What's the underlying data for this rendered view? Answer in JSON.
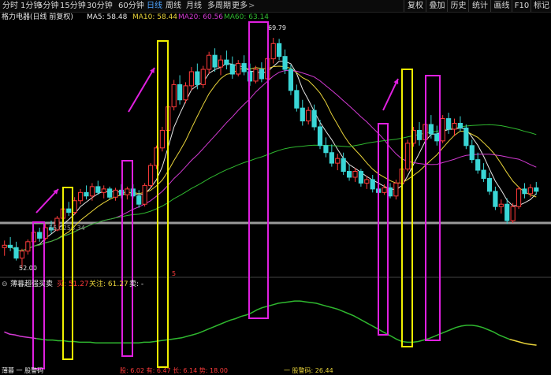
{
  "toolbar": {
    "periods": [
      "分时",
      "1分钟",
      "5分钟",
      "15分钟",
      "30分钟",
      "60分钟",
      "日线",
      "周线",
      "月线",
      "多周期",
      "更多"
    ],
    "active_index": 6,
    "more_arrow": ">",
    "right_buttons": [
      "复权",
      "叠加",
      "历史",
      "统计",
      "画线",
      "F10",
      "标记"
    ]
  },
  "title": {
    "stock": "格力电器(日线 前复权)",
    "ma5": "MA5: 58.48",
    "ma10": "MA10: 58.44",
    "ma20": "MA20: 60.56",
    "ma60": "MA60: 63.14"
  },
  "price_labels": {
    "high": "69.79",
    "low": "52.00",
    "ref_line": "55.0256.34",
    "marker": "5"
  },
  "indicator": {
    "name": "薄暮超强买卖",
    "buy": "买: 51.27",
    "watch": "关注: 61.27",
    "sell": "卖: -"
  },
  "bottom": {
    "left": "薄暮 一 股警码",
    "mid": "股: 6.02  有: 6.47  长: 6.14  势: 18.00",
    "right": "一 股警码: 26.44"
  },
  "colors": {
    "up": "#ff3b3b",
    "down": "#3ad6d6",
    "ma5": "#e8e8e8",
    "ma10": "#e8d33a",
    "ma20": "#d33ad3",
    "ma60": "#2fb82f",
    "box_magenta": "#e020e0",
    "box_yellow": "#f0f000",
    "arrow": "#e020e0"
  },
  "chart_data": {
    "type": "candlestick",
    "ohlc": [
      [
        51.9,
        52.5,
        51.2,
        52.1
      ],
      [
        52.1,
        52.8,
        51.6,
        51.9
      ],
      [
        51.9,
        52.4,
        50.8,
        51.0
      ],
      [
        51.0,
        51.8,
        50.2,
        51.6
      ],
      [
        51.6,
        52.6,
        51.3,
        52.4
      ],
      [
        52.4,
        53.4,
        52.1,
        53.2
      ],
      [
        53.2,
        53.6,
        52.4,
        52.7
      ],
      [
        52.7,
        53.9,
        52.5,
        53.6
      ],
      [
        53.6,
        54.2,
        53.1,
        53.4
      ],
      [
        53.4,
        54.6,
        53.3,
        54.4
      ],
      [
        54.4,
        55.5,
        54.1,
        55.2
      ],
      [
        55.2,
        55.8,
        54.6,
        54.9
      ],
      [
        54.9,
        56.2,
        54.7,
        55.9
      ],
      [
        55.9,
        56.9,
        55.6,
        56.6
      ],
      [
        56.6,
        57.2,
        56.0,
        56.3
      ],
      [
        56.3,
        57.4,
        55.9,
        57.1
      ],
      [
        57.1,
        57.6,
        56.4,
        56.6
      ],
      [
        56.6,
        57.2,
        56.1,
        56.9
      ],
      [
        56.9,
        57.1,
        56.0,
        56.2
      ],
      [
        56.2,
        57.0,
        55.9,
        56.8
      ],
      [
        56.8,
        57.3,
        56.1,
        56.4
      ],
      [
        56.4,
        57.1,
        56.0,
        56.9
      ],
      [
        56.9,
        57.3,
        56.1,
        56.3
      ],
      [
        56.3,
        56.8,
        55.3,
        55.6
      ],
      [
        55.6,
        57.4,
        55.4,
        57.2
      ],
      [
        57.2,
        59.1,
        57.0,
        58.9
      ],
      [
        58.9,
        60.6,
        58.6,
        60.4
      ],
      [
        60.4,
        62.2,
        60.1,
        61.9
      ],
      [
        61.9,
        64.2,
        61.6,
        63.9
      ],
      [
        63.9,
        66.2,
        63.6,
        65.8
      ],
      [
        65.8,
        66.6,
        64.1,
        64.5
      ],
      [
        64.5,
        66.0,
        64.2,
        65.7
      ],
      [
        65.7,
        67.3,
        65.3,
        66.9
      ],
      [
        66.9,
        67.6,
        65.4,
        65.8
      ],
      [
        65.8,
        67.4,
        65.5,
        67.1
      ],
      [
        67.1,
        68.6,
        66.7,
        68.3
      ],
      [
        68.3,
        68.9,
        66.9,
        67.3
      ],
      [
        67.3,
        68.3,
        66.6,
        67.9
      ],
      [
        67.9,
        68.7,
        67.1,
        67.5
      ],
      [
        67.5,
        68.2,
        66.3,
        66.7
      ],
      [
        66.7,
        67.9,
        66.5,
        67.6
      ],
      [
        67.6,
        68.3,
        66.6,
        66.9
      ],
      [
        66.9,
        67.6,
        65.7,
        66.1
      ],
      [
        66.1,
        67.4,
        65.9,
        67.1
      ],
      [
        67.1,
        67.7,
        66.0,
        66.3
      ],
      [
        66.3,
        68.2,
        66.1,
        68.0
      ],
      [
        68.0,
        69.79,
        67.6,
        69.3
      ],
      [
        69.3,
        69.7,
        67.9,
        68.2
      ],
      [
        68.2,
        68.8,
        66.7,
        67.1
      ],
      [
        67.1,
        67.5,
        64.9,
        65.3
      ],
      [
        65.3,
        65.8,
        63.5,
        63.8
      ],
      [
        63.8,
        64.5,
        62.3,
        62.7
      ],
      [
        62.7,
        63.9,
        62.4,
        63.6
      ],
      [
        63.6,
        64.1,
        61.9,
        62.2
      ],
      [
        62.2,
        62.8,
        60.3,
        60.6
      ],
      [
        60.6,
        61.3,
        59.6,
        60.0
      ],
      [
        60.0,
        60.7,
        58.8,
        59.1
      ],
      [
        59.1,
        59.9,
        58.5,
        59.5
      ],
      [
        59.5,
        60.0,
        58.1,
        58.4
      ],
      [
        58.4,
        59.0,
        57.6,
        57.9
      ],
      [
        57.9,
        58.7,
        57.5,
        58.4
      ],
      [
        58.4,
        58.6,
        57.1,
        57.4
      ],
      [
        57.4,
        58.0,
        56.9,
        57.7
      ],
      [
        57.7,
        58.1,
        56.6,
        56.9
      ],
      [
        56.9,
        57.4,
        56.3,
        56.6
      ],
      [
        56.6,
        57.3,
        56.4,
        57.0
      ],
      [
        57.0,
        57.4,
        56.1,
        56.3
      ],
      [
        56.3,
        57.7,
        56.0,
        57.4
      ],
      [
        57.4,
        58.9,
        57.2,
        58.6
      ],
      [
        58.6,
        61.1,
        58.4,
        60.8
      ],
      [
        60.8,
        62.2,
        60.5,
        61.9
      ],
      [
        61.9,
        62.6,
        60.6,
        61.1
      ],
      [
        61.1,
        62.8,
        60.9,
        62.4
      ],
      [
        62.4,
        63.2,
        61.2,
        61.6
      ],
      [
        61.6,
        62.3,
        60.6,
        61.0
      ],
      [
        61.0,
        63.2,
        60.8,
        62.9
      ],
      [
        62.9,
        63.4,
        61.6,
        62.0
      ],
      [
        62.0,
        62.9,
        61.4,
        62.5
      ],
      [
        62.5,
        63.1,
        61.8,
        62.1
      ],
      [
        62.1,
        62.4,
        60.3,
        60.6
      ],
      [
        60.6,
        61.1,
        59.1,
        59.4
      ],
      [
        59.4,
        60.0,
        58.2,
        58.5
      ],
      [
        58.5,
        59.1,
        57.5,
        57.8
      ],
      [
        57.8,
        58.3,
        56.4,
        56.7
      ],
      [
        56.7,
        57.1,
        55.1,
        55.4
      ],
      [
        55.4,
        56.0,
        54.8,
        55.6
      ],
      [
        55.6,
        56.1,
        53.9,
        54.2
      ],
      [
        54.2,
        55.7,
        54.0,
        55.4
      ],
      [
        55.4,
        57.1,
        55.2,
        56.9
      ],
      [
        56.9,
        57.4,
        56.1,
        56.5
      ],
      [
        56.5,
        57.3,
        56.2,
        57.0
      ],
      [
        57.0,
        57.5,
        56.4,
        56.7
      ]
    ],
    "ma_windows": [
      5,
      10,
      20,
      60
    ],
    "ylim": [
      49.5,
      71.0
    ],
    "ref_price": 54.0,
    "indicator_line": [
      20,
      17,
      16,
      14,
      13,
      12,
      11,
      10,
      9,
      9,
      8,
      8,
      7,
      7,
      6,
      6,
      6,
      5,
      5,
      5,
      5,
      5,
      5,
      5,
      5,
      5,
      6,
      6,
      7,
      8,
      9,
      10,
      11,
      12,
      14,
      16,
      18,
      21,
      24,
      27,
      30,
      33,
      36,
      38,
      41,
      43,
      46,
      50,
      53,
      55,
      57,
      59,
      60,
      61,
      62,
      62,
      61,
      60,
      59,
      57,
      55,
      53,
      51,
      48,
      45,
      42,
      38,
      34,
      30,
      26,
      22,
      18,
      14,
      10,
      7,
      6,
      6,
      7,
      9,
      11,
      14,
      17,
      20,
      23,
      26,
      28,
      29,
      29,
      28,
      26,
      23,
      20,
      16,
      13,
      10,
      8,
      6,
      4,
      3,
      2
    ],
    "indicator_ylim": [
      0,
      75
    ]
  }
}
